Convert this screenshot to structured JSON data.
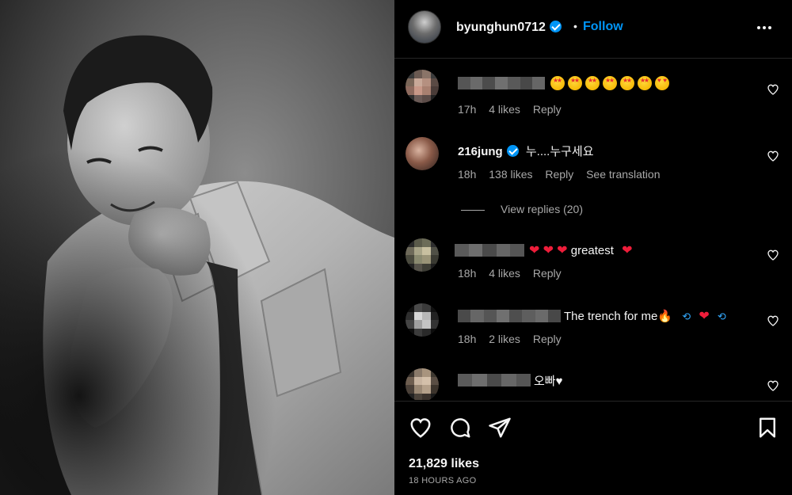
{
  "header": {
    "username": "byunghun0712",
    "separator": "•",
    "follow_label": "Follow"
  },
  "comments": [
    {
      "id": "c1",
      "username": "",
      "text_emoji": "🤩🤩🤩🤩🤩🤩🥰",
      "age": "17h",
      "likes": "4 likes",
      "reply": "Reply"
    },
    {
      "id": "c2",
      "username": "216jung",
      "text": "누....누구세요",
      "age": "18h",
      "likes": "138 likes",
      "reply": "Reply",
      "translation": "See translation",
      "view_replies": "View replies (20)"
    },
    {
      "id": "c3",
      "username": "",
      "text": "greatest",
      "age": "18h",
      "likes": "4 likes",
      "reply": "Reply"
    },
    {
      "id": "c4",
      "username": "",
      "text": "The trench for me",
      "age": "18h",
      "likes": "2 likes",
      "reply": "Reply"
    },
    {
      "id": "c5",
      "username": "",
      "text": "오빠♥"
    }
  ],
  "footer": {
    "likes": "21,829 likes",
    "time": "18 HOURS AGO"
  },
  "colors": {
    "accent": "#0095f6",
    "background": "#000000",
    "secondary_text": "#a8a8a8"
  },
  "icons": [
    "more-icon",
    "heart-icon",
    "comment-icon",
    "share-icon",
    "bookmark-icon",
    "verified-icon"
  ]
}
